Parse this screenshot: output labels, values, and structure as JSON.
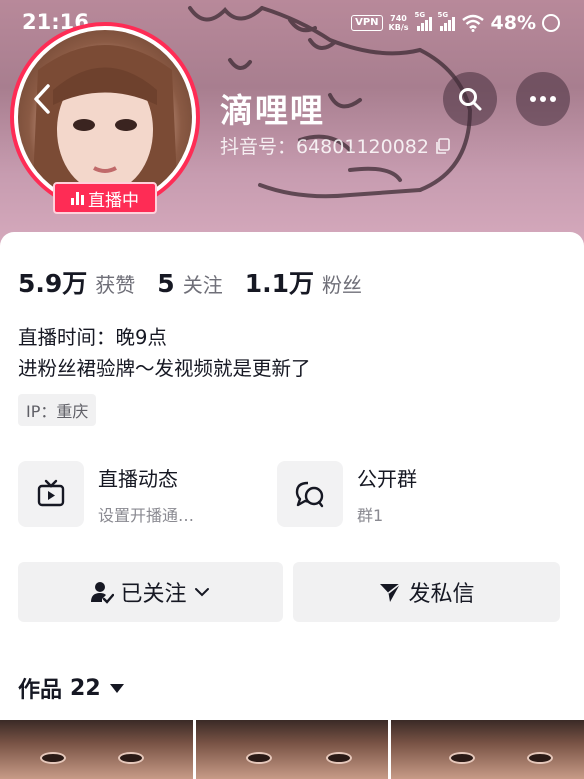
{
  "status_bar": {
    "time": "21:16",
    "vpn": "VPN",
    "speed_value": "740",
    "speed_unit": "KB/s",
    "network_1": "5G",
    "network_2": "5G",
    "battery": "48%"
  },
  "profile": {
    "nickname": "滴哩哩",
    "douyin_id": "抖音号：64801120082",
    "live_badge": "直播中"
  },
  "stats": [
    {
      "value": "5.9万",
      "label": "获赞"
    },
    {
      "value": "5",
      "label": "关注"
    },
    {
      "value": "1.1万",
      "label": "粉丝"
    }
  ],
  "bio": {
    "line1": "直播时间：晚9点",
    "line2": "进粉丝裙验牌～发视频就是更新了"
  },
  "ip": "IP：重庆",
  "features": [
    {
      "title": "直播动态",
      "subtitle": "设置开播通…",
      "icon": "tv-icon"
    },
    {
      "title": "公开群",
      "subtitle": "群1",
      "icon": "chat-group-icon"
    }
  ],
  "actions": {
    "follow_label": "已关注",
    "message_label": "发私信"
  },
  "works": {
    "label": "作品",
    "count": "22"
  },
  "colors": {
    "accent": "#fe2c55",
    "button_bg": "#f1f1f2",
    "text_primary": "#161823",
    "text_secondary": "#6f6f78"
  }
}
